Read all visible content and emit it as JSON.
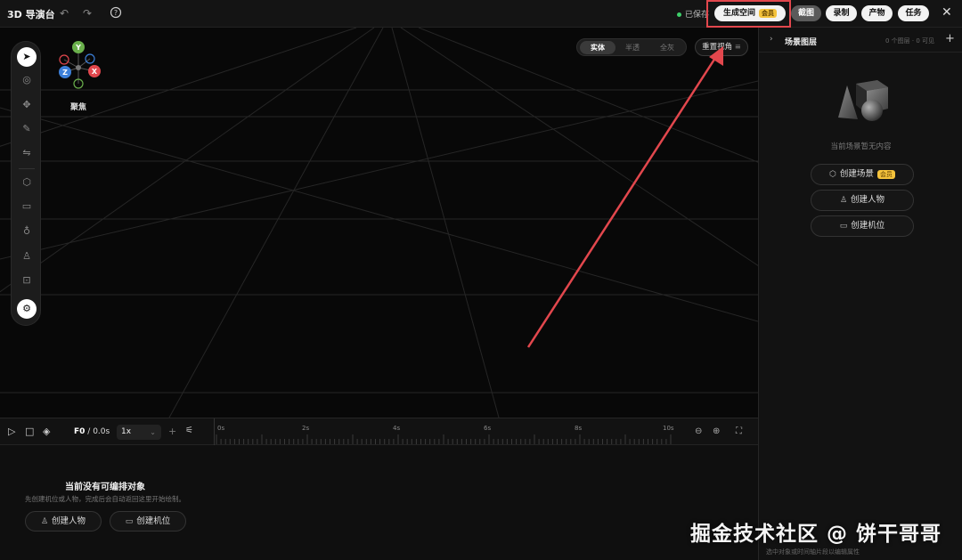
{
  "app": {
    "title": "3D 导演台",
    "saved_status": "已保存"
  },
  "topbar": {
    "generate_space": "生成空间",
    "vip_badge": "会员",
    "screenshot": "截图",
    "record": "录制",
    "product": "产物",
    "tasks": "任务",
    "close": "✕"
  },
  "viewport": {
    "modes": [
      "实体",
      "半透",
      "全灰"
    ],
    "active_mode": "实体",
    "reset_view": "重置视角",
    "focus_label": "聚焦",
    "axes": {
      "y": "Y",
      "x": "X",
      "z": "Z"
    },
    "colors": {
      "y": "#6ab04c",
      "x": "#e2474d",
      "z": "#3c7fd8"
    }
  },
  "right_panel": {
    "title": "场景图层",
    "count": "0 个图层 · 0 可见",
    "empty_text": "当前场景暂无内容",
    "buttons": {
      "create_scene": "创建场景",
      "create_person": "创建人物",
      "create_camera": "创建机位"
    },
    "vip_badge": "会员",
    "footer": "选中对象或时间轴片段以编辑属性"
  },
  "timeline": {
    "frame": "F0",
    "time": "/ 0.0s",
    "speed": "1x",
    "ticks": [
      "0s",
      "2s",
      "4s",
      "6s",
      "8s",
      "10s"
    ],
    "empty_title": "当前没有可编排对象",
    "empty_sub": "先创建机位或人物，完成后会自动返回这里开始绘制。",
    "create_person": "创建人物",
    "create_camera": "创建机位"
  },
  "watermark": "掘金技术社区 @ 饼干哥哥",
  "accent": {
    "highlight": "#e2474d",
    "vip": "#f4c23b",
    "saved": "#3ecf6a"
  }
}
